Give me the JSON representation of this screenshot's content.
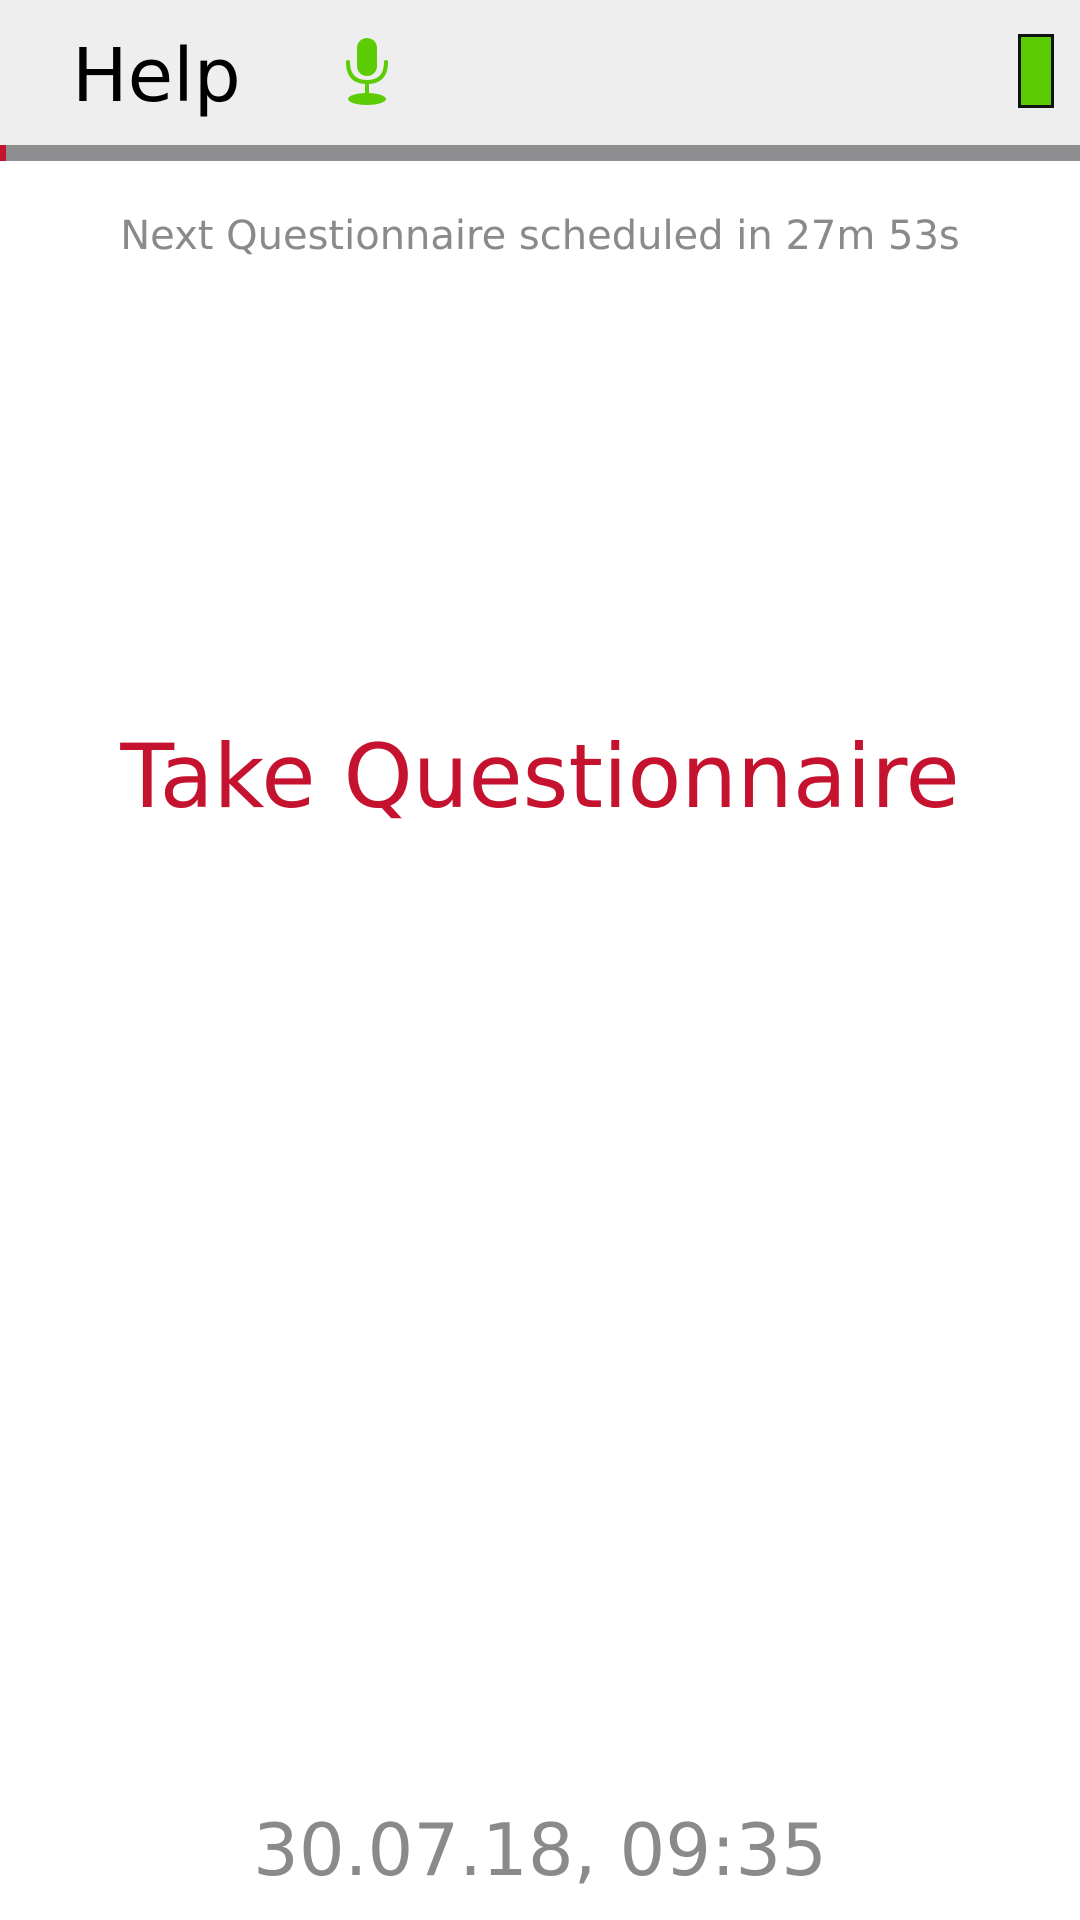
{
  "header": {
    "help_label": "Help",
    "mic_icon": "microphone-icon",
    "mic_color": "#5ccc05",
    "battery_icon": "battery-icon",
    "battery_color": "#5ccc05"
  },
  "progress": {
    "fraction": 0.006,
    "fill_color": "#c4122f",
    "track_color": "#8e8e90"
  },
  "main": {
    "next_questionnaire_text": "Next Questionnaire scheduled in 27m 53s",
    "take_button_label": "Take Questionnaire",
    "accent_color": "#c4122f"
  },
  "footer": {
    "datetime": "30.07.18, 09:35"
  }
}
